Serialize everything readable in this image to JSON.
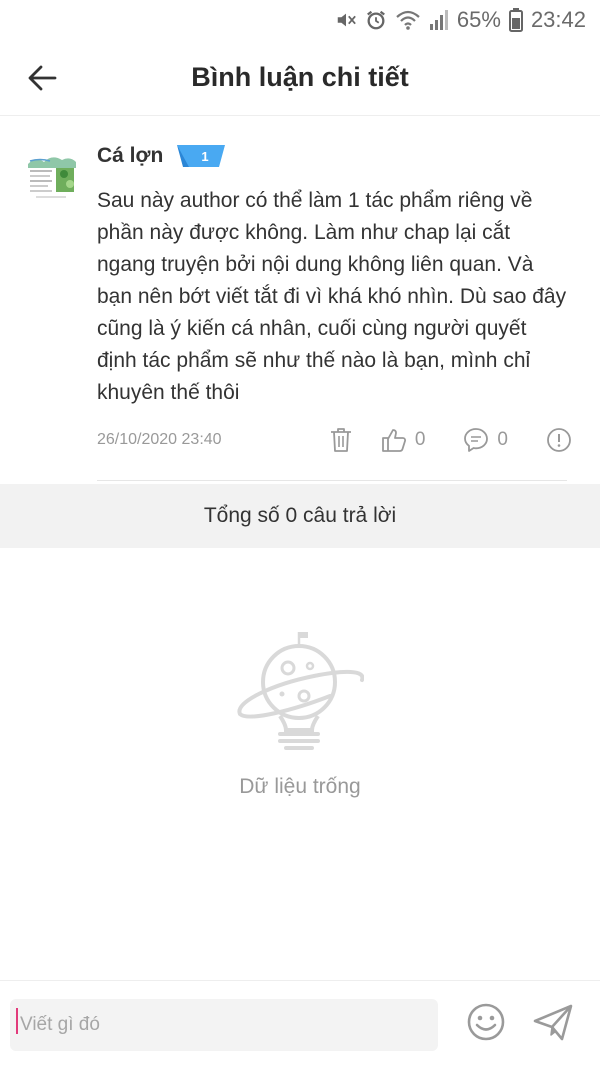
{
  "status_bar": {
    "battery_percent": "65%",
    "time": "23:42",
    "icons": [
      "mute-icon",
      "alarm-icon",
      "wifi-icon",
      "signal-icon",
      "battery-icon"
    ]
  },
  "header": {
    "title": "Bình luận chi tiết",
    "back_icon": "arrow-left-icon"
  },
  "comment": {
    "author": "Cá lợn",
    "level": "1",
    "text": "Sau này author có thể làm 1 tác phẩm riêng về phần này được không. Làm như chap lại cắt ngang truyện bởi nội dung không liên quan. Và bạn nên bớt viết tắt đi vì khá khó nhìn. Dù sao đây cũng là ý kiến cá nhân, cuối cùng người quyết định tác phẩm sẽ như thế nào là bạn, mình chỉ khuyên thế thôi",
    "timestamp": "26/10/2020 23:40",
    "likes": "0",
    "replies": "0",
    "actions": [
      "trash-icon",
      "thumbs-up-icon",
      "chat-bubble-icon",
      "report-icon"
    ]
  },
  "replies_summary": "Tổng số 0 câu trả lời",
  "empty_state": {
    "icon": "planet-lightbulb-icon",
    "text": "Dữ liệu trống"
  },
  "composer": {
    "placeholder": "Viết gì đó",
    "value": "",
    "emoji_icon": "smiley-icon",
    "send_icon": "send-icon"
  },
  "colors": {
    "accent_caret": "#e23b7b",
    "badge_blue": "#3aa0f0",
    "muted_text": "#999999",
    "section_bg": "#f2f2f2"
  }
}
